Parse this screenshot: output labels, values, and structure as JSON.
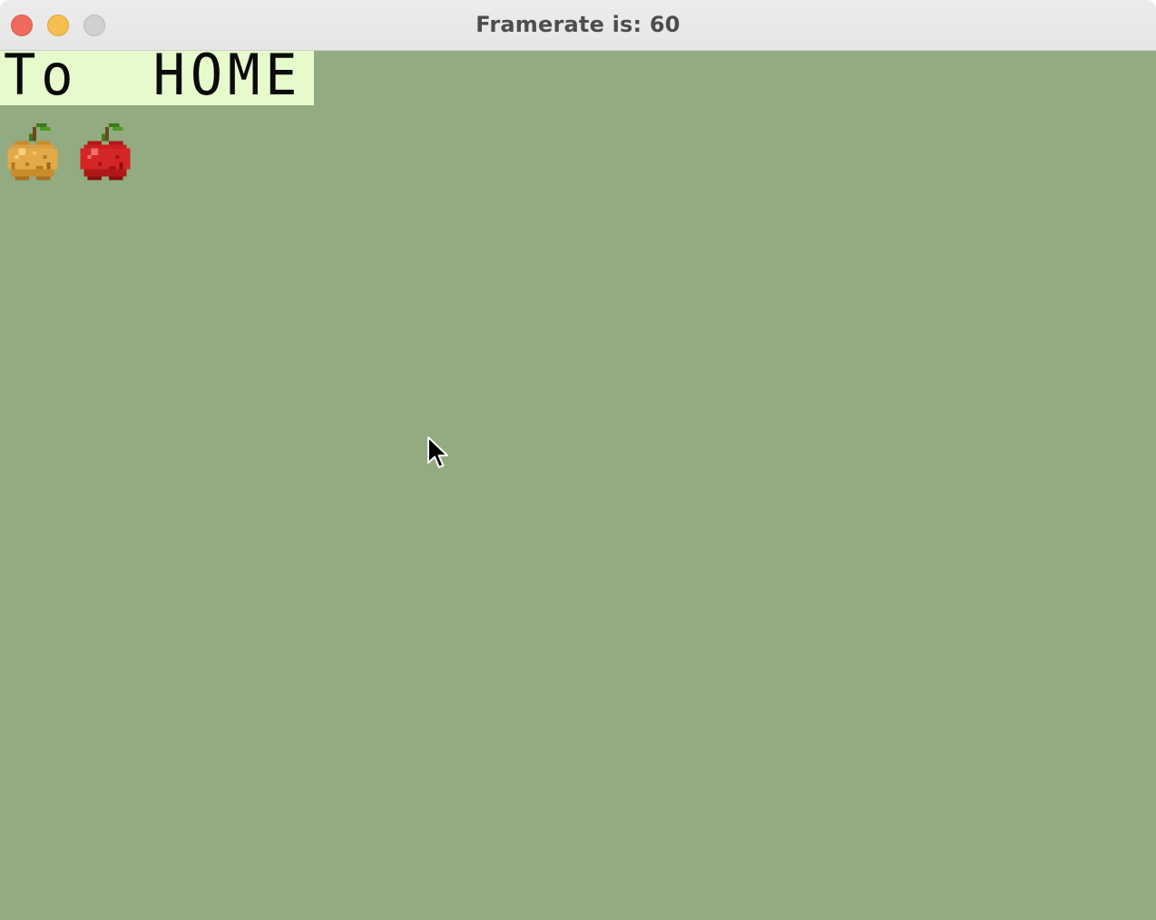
{
  "window": {
    "title": "Framerate is: 60",
    "controls": [
      "close",
      "minimize",
      "zoom"
    ]
  },
  "canvas": {
    "background_color": "#92ab80"
  },
  "home_button": {
    "label": "To  HOME",
    "background_color": "#e6facc",
    "icon": "handwritten-label"
  },
  "inventory": [
    {
      "name": "golden-apple",
      "icon": "golden-apple-icon"
    },
    {
      "name": "red-apple",
      "icon": "red-apple-icon"
    }
  ],
  "cursor": {
    "icon": "arrow-cursor-icon"
  }
}
